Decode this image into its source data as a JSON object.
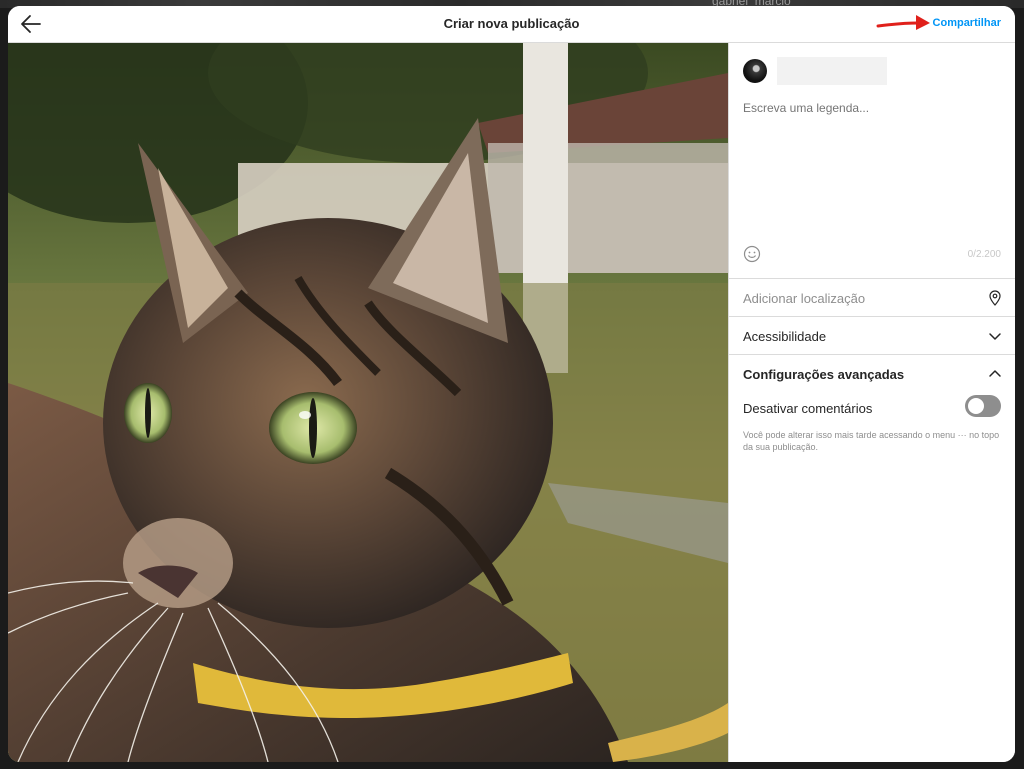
{
  "backdrop": {
    "partial_name": "gabriel_marcio"
  },
  "header": {
    "title": "Criar nova publicação",
    "back_icon": "arrow-left-icon",
    "share_label": "Compartilhar",
    "share_color": "#0095f6"
  },
  "annotation": {
    "arrow_color": "#e0201b"
  },
  "photo": {
    "subject": "cat-photo"
  },
  "composer": {
    "caption_placeholder": "Escreva uma legenda...",
    "char_count": "0/2.200",
    "emoji_icon": "smiley-icon"
  },
  "options": {
    "location_label": "Adicionar localização",
    "location_icon": "map-pin-icon",
    "accessibility_label": "Acessibilidade",
    "accessibility_icon": "chevron-down-icon",
    "advanced_label": "Configurações avançadas",
    "advanced_icon": "chevron-up-icon",
    "disable_comments_label": "Desativar comentários",
    "disable_comments_on": false,
    "help_text": "Você pode alterar isso mais tarde acessando o menu ··· no topo da sua publicação."
  }
}
